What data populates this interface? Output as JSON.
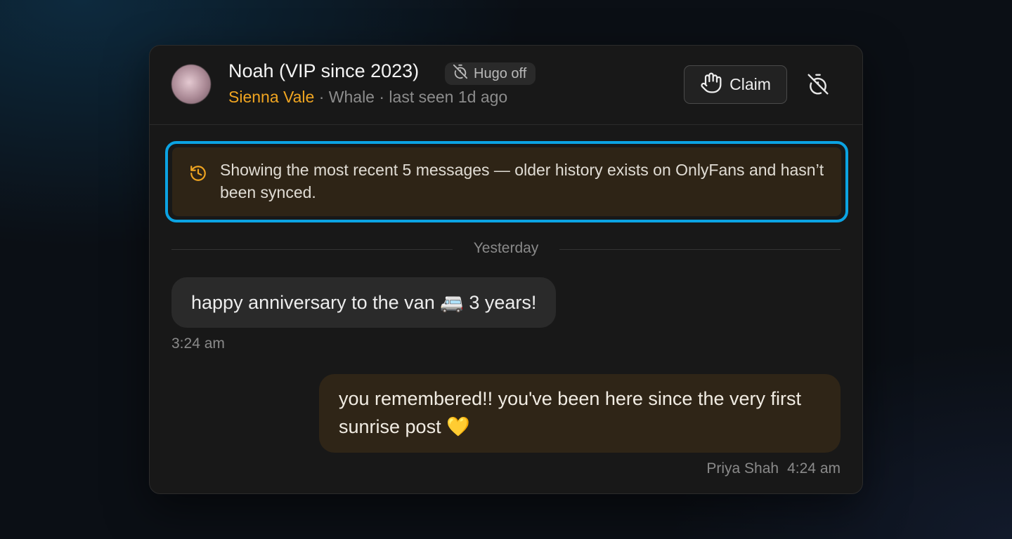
{
  "header": {
    "name": "Noah (VIP since 2023)",
    "hugo_badge": "Hugo off",
    "creator": "Sienna Vale",
    "sub_meta": " · Whale · last seen 1d ago",
    "claim_label": "Claim"
  },
  "notice": {
    "text": "Showing the most recent 5 messages — older history exists on OnlyFans and hasn’t been synced."
  },
  "thread": {
    "divider_label": "Yesterday",
    "messages": [
      {
        "direction": "incoming",
        "text": "happy anniversary to the van 🚐 3 years!",
        "time": "3:24 am"
      },
      {
        "direction": "outgoing",
        "text": "you remembered!! you've been here since the very first sunrise post 💛",
        "sender": "Priya Shah",
        "time": "4:24 am"
      }
    ]
  },
  "colors": {
    "accent_orange": "#f0a521",
    "focus_ring": "#0ba3e3",
    "card_bg": "#181818"
  },
  "icons": {
    "hugo_badge": "timer-off-icon",
    "claim": "hand-icon",
    "header_action": "timer-off-icon",
    "notice": "history-icon"
  }
}
